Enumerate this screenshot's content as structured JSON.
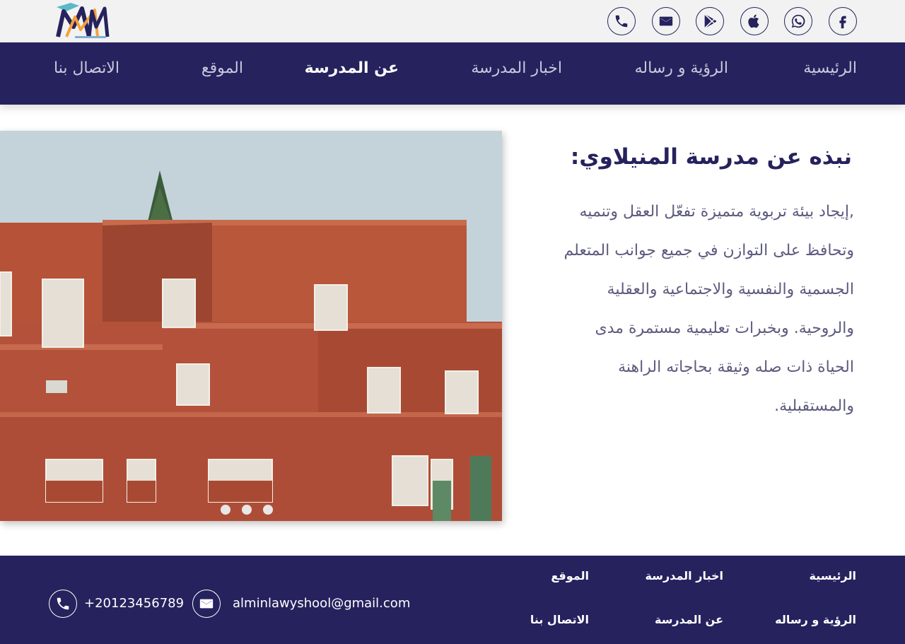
{
  "colors": {
    "primary": "#26225e",
    "topbar": "#f2f2f2",
    "text_muted": "#5d5b7e",
    "accent": "#f2a23a"
  },
  "topbar": {
    "logo": "school-logo",
    "social_icons": [
      "facebook-icon",
      "whatsapp-icon",
      "apple-icon",
      "google-play-icon",
      "mail-icon",
      "phone-icon"
    ]
  },
  "nav": {
    "items": [
      "الرئيسية",
      "الرؤية و رساله",
      "اخبار المدرسة",
      "عن المدرسة",
      "الموقع",
      "الاتصال بنا"
    ],
    "active_index": 3
  },
  "hero": {
    "image": "school-building-photo",
    "slides": 3
  },
  "about": {
    "title": "نبذه عن مدرسة المنيلاوي:",
    "lines": [
      ",إيجاد بيئة تربوية متميزة تفعّل العقل وتنميه",
      "وتحافظ على التوازن في جميع جوانب المتعلم",
      "الجسمية والنفسية والاجتماعية والعقلية",
      "والروحية. وبخبرات تعليمية مستمرة مدى",
      "الحياة ذات صله وثيقة بحاجاته الراهنة",
      "والمستقبلية."
    ]
  },
  "footer": {
    "links": [
      "الرئيسية",
      "اخبار المدرسة",
      "الموقع",
      "الرؤية و رساله",
      "عن المدرسة",
      "الاتصال بنا"
    ],
    "email": "alminlawyshool@gmail.com",
    "phone": "+20123456789"
  }
}
